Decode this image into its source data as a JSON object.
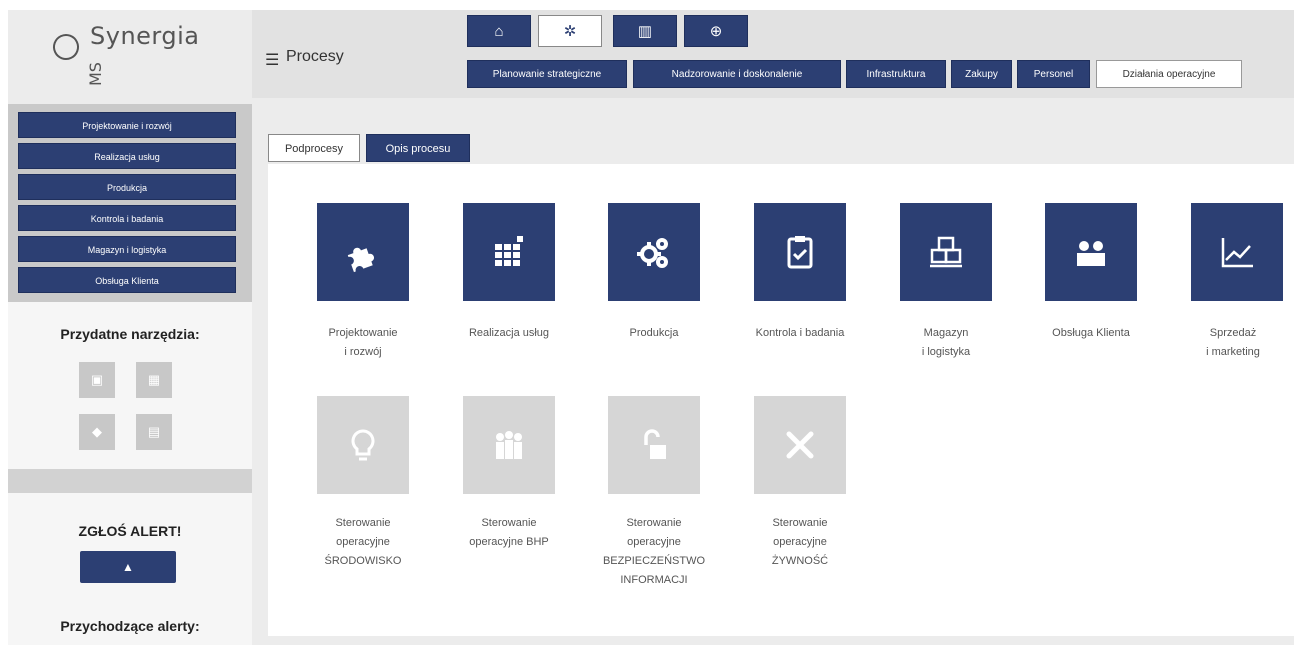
{
  "logo": {
    "name": "Synergia",
    "sub": "MS"
  },
  "header": {
    "menu_icon": "hamburger-icon",
    "title": "Procesy"
  },
  "icon_tabs": [
    {
      "icon": "home-icon",
      "glyph": "⌂",
      "active": false
    },
    {
      "icon": "process-icon",
      "glyph": "✲",
      "active": true
    },
    {
      "icon": "chart-icon",
      "glyph": "▥",
      "active": false
    },
    {
      "icon": "globe-icon",
      "glyph": "⊕",
      "active": false
    }
  ],
  "category_tabs": [
    {
      "label": "Planowanie strategiczne",
      "active": false
    },
    {
      "label": "Nadzorowanie i doskonalenie",
      "active": false
    },
    {
      "label": "Infrastruktura",
      "active": false
    },
    {
      "label": "Zakupy",
      "active": false
    },
    {
      "label": "Personel",
      "active": false
    },
    {
      "label": "Działania operacyjne",
      "active": true
    }
  ],
  "sidebar": {
    "items": [
      {
        "label": "Projektowanie i rozwój"
      },
      {
        "label": "Realizacja usług"
      },
      {
        "label": "Produkcja"
      },
      {
        "label": "Kontrola i badania"
      },
      {
        "label": "Magazyn i logistyka"
      },
      {
        "label": "Obsługa Klienta"
      }
    ],
    "tools_title": "Przydatne narzędzia:",
    "tools": [
      {
        "icon": "briefcase-icon",
        "glyph": "▣"
      },
      {
        "icon": "calendar-icon",
        "glyph": "▦"
      },
      {
        "icon": "chat-icon",
        "glyph": "◆"
      },
      {
        "icon": "document-icon",
        "glyph": "▤"
      }
    ],
    "alert_title": "ZGŁOŚ ALERT!",
    "alert_button_icon": "bell-icon",
    "alert_button_glyph": "▲",
    "incoming_title": "Przychodzące alerty:"
  },
  "sub_tabs": [
    {
      "label": "Podprocesy",
      "active": true
    },
    {
      "label": "Opis procesu",
      "active": false
    }
  ],
  "processes": [
    {
      "label_lines": [
        "Projektowanie",
        "i rozwój"
      ],
      "icon": "puzzle-icon",
      "enabled": true
    },
    {
      "label_lines": [
        "Realizacja usług"
      ],
      "icon": "grid-icon",
      "enabled": true
    },
    {
      "label_lines": [
        "Produkcja"
      ],
      "icon": "gears-icon",
      "enabled": true
    },
    {
      "label_lines": [
        "Kontrola i badania"
      ],
      "icon": "clipboard-check-icon",
      "enabled": true
    },
    {
      "label_lines": [
        "Magazyn",
        "i logistyka"
      ],
      "icon": "boxes-icon",
      "enabled": true
    },
    {
      "label_lines": [
        "Obsługa Klienta"
      ],
      "icon": "people-icon",
      "enabled": true
    },
    {
      "label_lines": [
        "Sprzedaż",
        "i marketing"
      ],
      "icon": "line-chart-icon",
      "enabled": true
    },
    {
      "label_lines": [
        "Sterowanie",
        "operacyjne",
        "ŚRODOWISKO"
      ],
      "icon": "lightbulb-icon",
      "enabled": false
    },
    {
      "label_lines": [
        "Sterowanie",
        "operacyjne BHP"
      ],
      "icon": "group-icon",
      "enabled": false
    },
    {
      "label_lines": [
        "Sterowanie",
        "operacyjne",
        "BEZPIECZEŃSTWO",
        "INFORMACJI"
      ],
      "icon": "unlock-icon",
      "enabled": false
    },
    {
      "label_lines": [
        "Sterowanie",
        "operacyjne",
        "ŻYWNOŚĆ"
      ],
      "icon": "cutlery-icon",
      "enabled": false
    }
  ]
}
